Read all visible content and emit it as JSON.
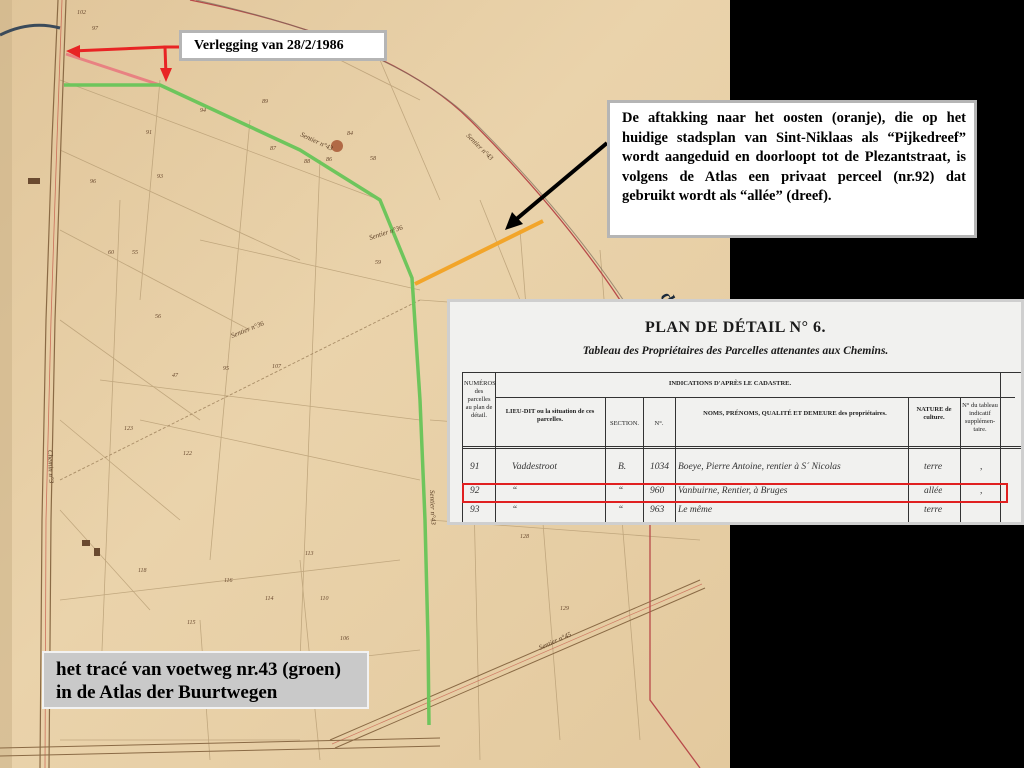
{
  "callouts": {
    "relocation": "Verlegging van 28/2/1986",
    "branch": "De aftakking  naar het oosten (oranje), die op het huidige stadsplan van Sint-Niklaas als “Pijkedreef” wordt aangeduid en doorloopt tot de Plezantstraat, is volgens de Atlas een privaat perceel (nr.92) dat gebruikt wordt als “allée” (dreef)."
  },
  "caption": {
    "line1": "het tracé van voetweg nr.43 (groen)",
    "line2": "in de Atlas der Buurtwegen"
  },
  "map_labels": {
    "sentier_a": "Sentier n°43",
    "sentier_b": "Sentier n°36",
    "sentier_c": "Sentier n°43",
    "sentier_d": "Sentier n°43",
    "sentier_e": "Sentier n°36",
    "chemin": "Chemin n°3",
    "sentier_f": "Sentier n°45",
    "parcel_numbers": [
      "102",
      "97",
      "96",
      "91",
      "93",
      "94",
      "89",
      "87",
      "88",
      "86",
      "84",
      "58",
      "59",
      "60",
      "55",
      "56",
      "47",
      "123",
      "122",
      "118",
      "115",
      "116",
      "114",
      "113",
      "110",
      "106",
      "105",
      "104",
      "103",
      "128",
      "129",
      "131",
      "135",
      "107",
      "95"
    ]
  },
  "table_excerpt": {
    "title": "PLAN DE DÉTAIL N° 6.",
    "subtitle": "Tableau des Propriétaires des Parcelles attenantes aux Chemins.",
    "headers": {
      "num_parcel": "NUMÉROS des parcelles au plan de détail.",
      "cadastre": "INDICATIONS D'APRÈS LE CADASTRE.",
      "lieu_dit": "LIEU-DIT ou la situation de ces parcelles.",
      "section": "SECTION.",
      "number": "N°.",
      "owners": "NOMS, PRÉNOMS, QUALITÉ ET DEMEURE des propriétaires.",
      "nature": "NATURE de culture.",
      "tableau": "N° du tableau indicatif supplémen-taire."
    },
    "rows": [
      {
        "num": "91",
        "lieu": "Vaddestroot",
        "section": "B.",
        "no": "1034",
        "owner": "Boeye, Pierre Antoine, rentier à S´ Nicolas",
        "nature": "terre",
        "tab": ","
      },
      {
        "num": "92",
        "lieu": "“",
        "section": "“",
        "no": "960",
        "owner": "Vanbuirne, Rentier, à Bruges",
        "nature": "allée",
        "tab": ","
      },
      {
        "num": "93",
        "lieu": "“",
        "section": "“",
        "no": "963",
        "owner": "Le même",
        "nature": "terre",
        "tab": ""
      }
    ]
  },
  "colors": {
    "green_path": "#6ec55c",
    "orange_branch": "#f2a52a",
    "red_relocation": "#e82424",
    "highlight": "#e02020",
    "map_paper": "#e7cfa6"
  }
}
